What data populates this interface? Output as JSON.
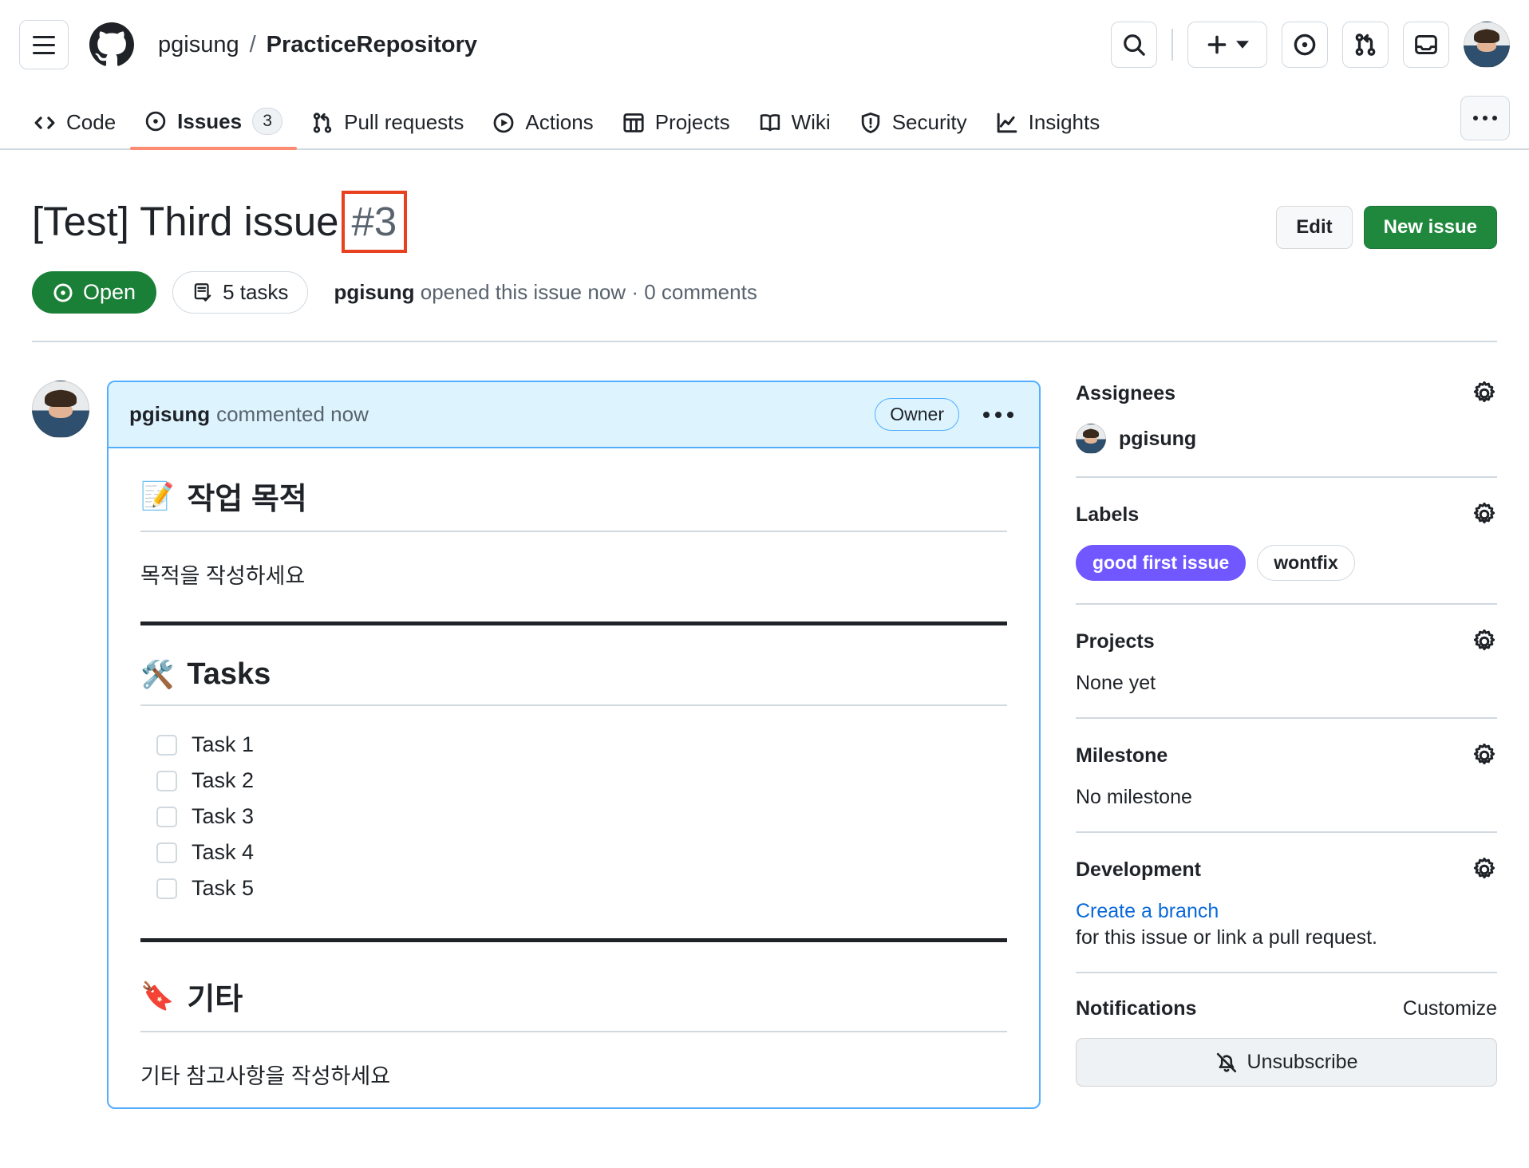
{
  "header": {
    "menu_label": "Open global navigation menu",
    "logo_name": "GitHub",
    "owner": "pgisung",
    "separator": "/",
    "repo": "PracticeRepository",
    "icons": [
      "search-icon",
      "plus-icon",
      "issue-opened-icon",
      "pull-request-icon",
      "inbox-icon",
      "avatar"
    ]
  },
  "nav": {
    "items": [
      {
        "label": "Code",
        "icon": "code-icon",
        "count": null,
        "active": false
      },
      {
        "label": "Issues",
        "icon": "issue-opened-icon",
        "count": "3",
        "active": true
      },
      {
        "label": "Pull requests",
        "icon": "pull-request-icon",
        "count": null,
        "active": false
      },
      {
        "label": "Actions",
        "icon": "play-icon",
        "count": null,
        "active": false
      },
      {
        "label": "Projects",
        "icon": "table-icon",
        "count": null,
        "active": false
      },
      {
        "label": "Wiki",
        "icon": "book-icon",
        "count": null,
        "active": false
      },
      {
        "label": "Security",
        "icon": "shield-icon",
        "count": null,
        "active": false
      },
      {
        "label": "Insights",
        "icon": "graph-icon",
        "count": null,
        "active": false
      }
    ],
    "more_label": "More"
  },
  "issue": {
    "title": "[Test] Third issue",
    "number": "#3",
    "edit_label": "Edit",
    "new_issue_label": "New issue",
    "state": "Open",
    "tasks_pill": "5 tasks",
    "author": "pgisung",
    "meta_action": "opened this issue",
    "meta_time": "now",
    "meta_separator": "·",
    "comments": "0 comments"
  },
  "comment": {
    "author": "pgisung",
    "action": "commented",
    "time": "now",
    "role_badge": "Owner",
    "sections": [
      {
        "emoji": "📝",
        "heading": "작업 목적",
        "paragraph": "목적을 작성하세요"
      },
      {
        "emoji": "🛠️",
        "heading": "Tasks",
        "paragraph": ""
      },
      {
        "emoji": "🔖",
        "heading": "기타",
        "paragraph": "기타 참고사항을 작성하세요"
      }
    ],
    "tasks": [
      "Task 1",
      "Task 2",
      "Task 3",
      "Task 4",
      "Task 5"
    ]
  },
  "sidebar": {
    "assignees": {
      "title": "Assignees",
      "user": "pgisung"
    },
    "labels": {
      "title": "Labels",
      "items": [
        {
          "name": "good first issue",
          "bg": "#7057ff",
          "fg": "#ffffff",
          "border": "#7057ff"
        },
        {
          "name": "wontfix",
          "bg": "#ffffff",
          "fg": "#1f2328",
          "border": "#d1d9e0"
        }
      ]
    },
    "projects": {
      "title": "Projects",
      "value": "None yet"
    },
    "milestone": {
      "title": "Milestone",
      "value": "No milestone"
    },
    "development": {
      "title": "Development",
      "link": "Create a branch",
      "text": "for this issue or link a pull request."
    },
    "notifications": {
      "title": "Notifications",
      "customize": "Customize",
      "button": "Unsubscribe"
    }
  },
  "colors": {
    "open_green": "#1a7f37",
    "primary_green": "#1f883d",
    "accent_blue": "#0969da",
    "comment_blue": "#54aeff",
    "comment_blue_bg": "#ddf4ff",
    "label_purple": "#7057ff",
    "annotation_red": "#e8411f",
    "tab_underline": "#fd8c73",
    "border_gray": "#d1d9e0",
    "muted_text": "#59636e"
  }
}
